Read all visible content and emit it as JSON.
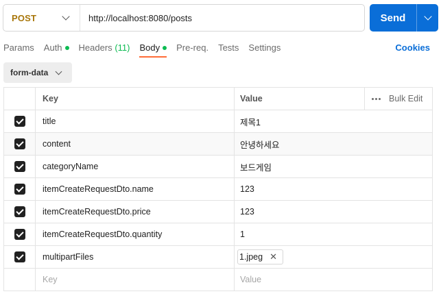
{
  "request": {
    "method": "POST",
    "url": "http://localhost:8080/posts",
    "send_label": "Send"
  },
  "tabs": [
    {
      "label": "Params",
      "indicator": ""
    },
    {
      "label": "Auth",
      "indicator": "dot"
    },
    {
      "label": "Headers",
      "indicator": "(11)"
    },
    {
      "label": "Body",
      "indicator": "dot"
    },
    {
      "label": "Pre-req.",
      "indicator": ""
    },
    {
      "label": "Tests",
      "indicator": ""
    },
    {
      "label": "Settings",
      "indicator": ""
    }
  ],
  "active_tab": "Body",
  "cookies_label": "Cookies",
  "body_type": "form-data",
  "table": {
    "key_header": "Key",
    "value_header": "Value",
    "bulk_edit_label": "Bulk Edit",
    "rows": [
      {
        "key": "title",
        "value": "제목1",
        "checked": true
      },
      {
        "key": "content",
        "value": "안녕하세요",
        "checked": true
      },
      {
        "key": "categoryName",
        "value": "보드게임",
        "checked": true
      },
      {
        "key": "itemCreateRequestDto.name",
        "value": "123",
        "checked": true
      },
      {
        "key": "itemCreateRequestDto.price",
        "value": "123",
        "checked": true
      },
      {
        "key": "itemCreateRequestDto.quantity",
        "value": "1",
        "checked": true
      },
      {
        "key": "multipartFiles",
        "value": "1.jpeg",
        "checked": true,
        "type": "file"
      }
    ],
    "key_placeholder": "Key",
    "value_placeholder": "Value"
  },
  "colors": {
    "method": "#a8760a",
    "send": "#0a6ed8",
    "active_tab_underline": "#ff6c37",
    "indicator": "#0cbb52"
  }
}
